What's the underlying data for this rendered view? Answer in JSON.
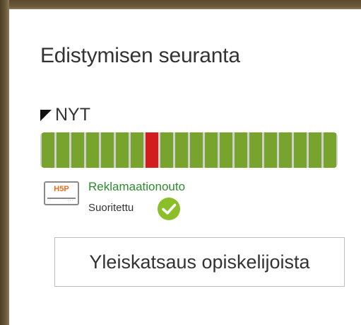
{
  "block": {
    "title": "Edistymisen seuranta"
  },
  "now_marker": {
    "label": "NYT"
  },
  "progress": {
    "total_segments": 20,
    "current_index": 7,
    "colors": {
      "completed": "#78a32d",
      "current": "#d11d1d",
      "track": "#cfcfcf"
    }
  },
  "activity": {
    "icon": "h5p-icon",
    "icon_text": "H5P",
    "name": "Reklamaationouto",
    "status": "Suoritettu",
    "status_icon": "check-circle-icon",
    "status_color": "#8bbf2a"
  },
  "overview_button": {
    "label": "Yleiskatsaus opiskelijoista"
  }
}
